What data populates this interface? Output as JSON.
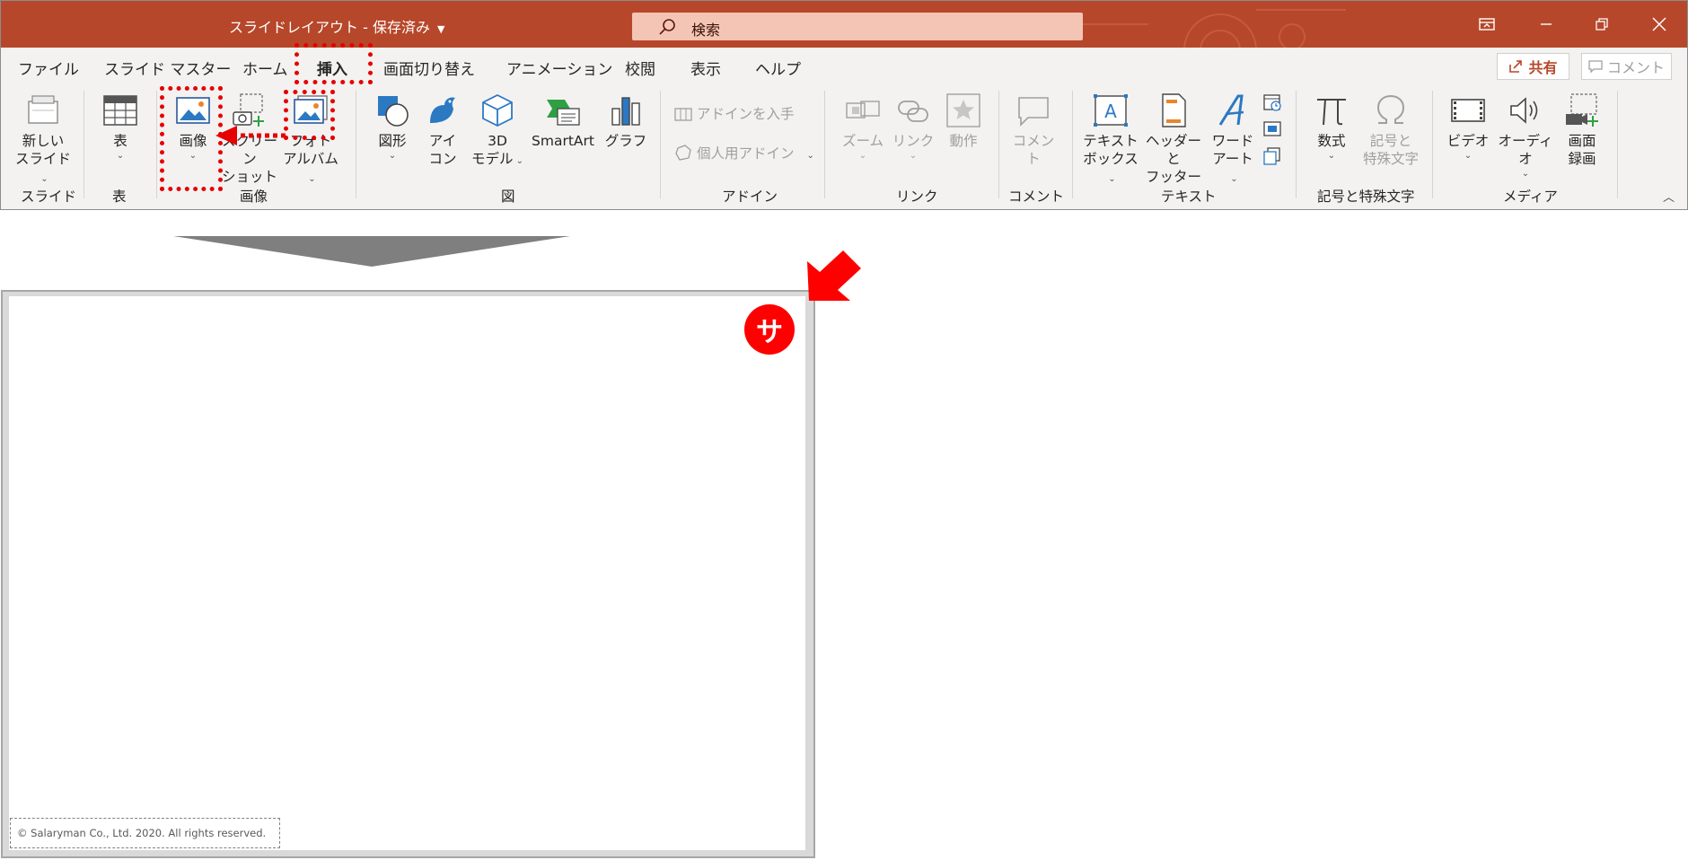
{
  "window": {
    "title": "スライドレイアウト - 保存済み",
    "search_placeholder": "検索"
  },
  "tabs": [
    {
      "label": "ファイル"
    },
    {
      "label": "スライド マスター"
    },
    {
      "label": "ホーム"
    },
    {
      "label": "挿入",
      "active": true
    },
    {
      "label": "画面切り替え"
    },
    {
      "label": "アニメーション"
    },
    {
      "label": "校閲"
    },
    {
      "label": "表示"
    },
    {
      "label": "ヘルプ"
    }
  ],
  "actions": {
    "share": "共有",
    "comment": "コメント"
  },
  "ribbon": {
    "groups": {
      "slides": "スライド",
      "table": "表",
      "images": "画像",
      "illustrations": "図",
      "addins": "アドイン",
      "links": "リンク",
      "comments": "コメント",
      "text": "テキスト",
      "symbols": "記号と特殊文字",
      "media": "メディア"
    },
    "buttons": {
      "new_slide": [
        "新しい",
        "スライド"
      ],
      "table": "表",
      "pictures": "画像",
      "screenshot": [
        "スクリーン",
        "ショット"
      ],
      "photo_album": [
        "フォト",
        "アルバム"
      ],
      "shapes": "図形",
      "icons": [
        "アイ",
        "コン"
      ],
      "models3d": [
        "3D",
        "モデル"
      ],
      "smartart": "SmartArt",
      "chart": "グラフ",
      "get_addins": "アドインを入手",
      "my_addins": "個人用アドイン",
      "zoom": "ズーム",
      "link": "リンク",
      "action": "動作",
      "comment": "コメント",
      "textbox": [
        "テキスト",
        "ボックス"
      ],
      "header_footer": [
        "ヘッダーと",
        "フッター"
      ],
      "wordart": [
        "ワード",
        "アート"
      ],
      "equation": "数式",
      "symbol": [
        "記号と",
        "特殊文字"
      ],
      "video": "ビデオ",
      "audio": "オーディオ",
      "screen_recording": [
        "画面",
        "録画"
      ]
    }
  },
  "slide": {
    "copyright": "© Salaryman Co., Ltd. 2020. All rights reserved.",
    "badge": "サ"
  },
  "colors": {
    "titlebar": "#b7472a",
    "annotation": "#e60000",
    "ribbon_bg": "#f3f2f1"
  }
}
